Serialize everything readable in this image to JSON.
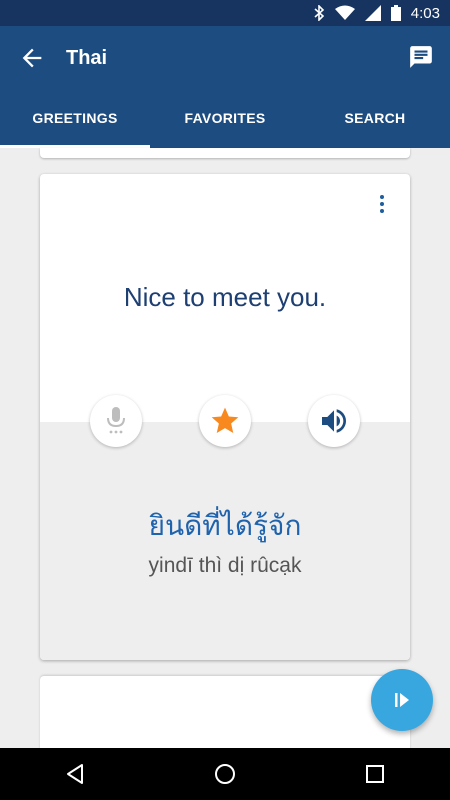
{
  "status_bar": {
    "time": "4:03",
    "icons": [
      "bluetooth-icon",
      "wifi-icon",
      "signal-icon",
      "battery-icon"
    ]
  },
  "app_bar": {
    "title": "Thai",
    "back_icon": "arrow-back-icon",
    "action_icon": "chat-icon"
  },
  "tabs": [
    {
      "label": "GREETINGS",
      "active": true
    },
    {
      "label": "FAVORITES",
      "active": false
    },
    {
      "label": "SEARCH",
      "active": false
    }
  ],
  "card": {
    "english": "Nice to meet you.",
    "thai": "ยินดีที่ได้รู้จัก",
    "transliteration": "yindī thì dị rûcạk",
    "buttons": [
      "mic-icon",
      "star-icon",
      "speaker-icon"
    ],
    "menu_icon": "more-vert-icon"
  },
  "fab": {
    "icon": "play-icon"
  },
  "nav_bar": [
    "back-triangle-icon",
    "home-circle-icon",
    "recents-square-icon"
  ],
  "colors": {
    "status_bar": "#16345f",
    "app_bar": "#1d4c80",
    "star": "#f7891f",
    "fab": "#38a7e0",
    "thai_text": "#1f63ad",
    "english_text": "#1d3f72"
  }
}
